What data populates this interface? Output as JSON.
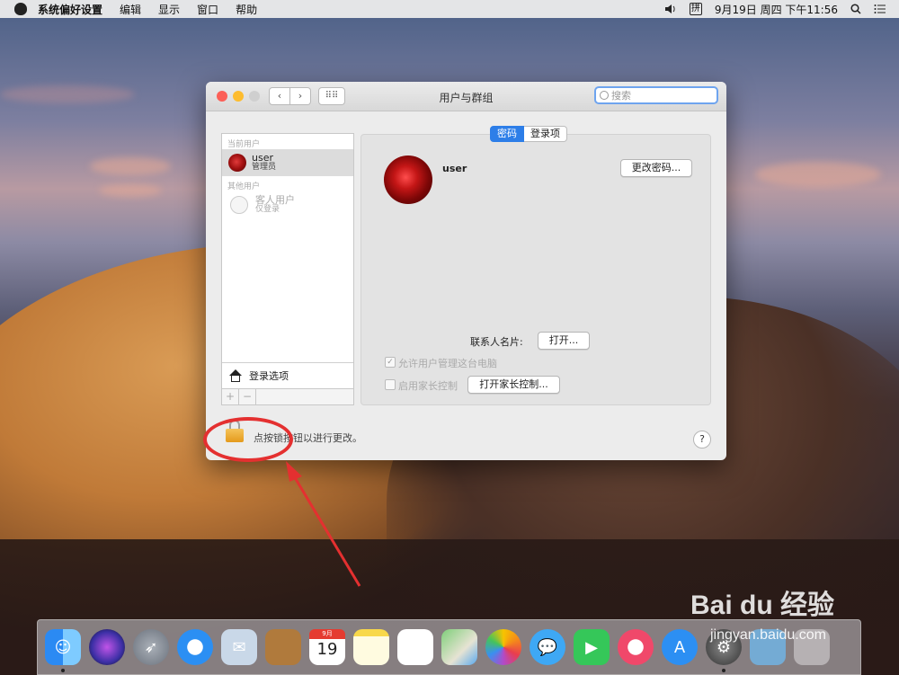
{
  "menubar": {
    "items": [
      "系统偏好设置",
      "编辑",
      "显示",
      "窗口",
      "帮助"
    ],
    "input_method": "拼",
    "clock": "9月19日 周四 下午11:56"
  },
  "window": {
    "title": "用户与群组",
    "search_placeholder": "搜索"
  },
  "sidebar": {
    "current_users_label": "当前用户",
    "current_user": {
      "name": "user",
      "role": "管理员"
    },
    "other_users_label": "其他用户",
    "guest_user": {
      "name": "客人用户",
      "status": "仅登录"
    },
    "login_options": "登录选项",
    "add": "+",
    "remove": "−"
  },
  "tabs": {
    "password": "密码",
    "login_items": "登录项"
  },
  "main": {
    "username": "user",
    "change_password": "更改密码...",
    "contact_card_label": "联系人名片:",
    "open_button": "打开...",
    "allow_admin": "允许用户管理这台电脑",
    "allow_admin_checked": "✓",
    "parental_controls": "启用家长控制",
    "open_parental_controls": "打开家长控制...",
    "lock_message": "点按锁按钮以进行更改。",
    "help": "?"
  },
  "dock": {
    "calendar_month": "9月",
    "calendar_day": "19"
  },
  "watermark": {
    "brand": "Bai du 经验",
    "url": "jingyan.baidu.com"
  },
  "colors": {
    "accent": "#2d7ee8",
    "annotation": "#e43030"
  }
}
